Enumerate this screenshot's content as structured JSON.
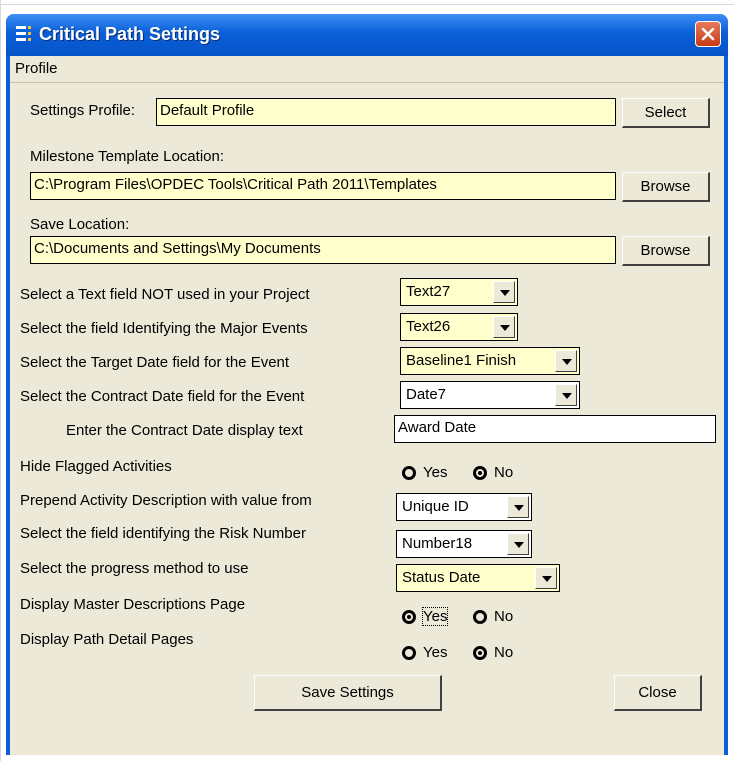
{
  "window": {
    "title": "Critical Path Settings",
    "close_symbol": "✕",
    "colors": {
      "titlebar": "#0a5fd8",
      "client": "#ece9d8",
      "field_yellow": "#ffffcc"
    }
  },
  "menu": {
    "items": [
      {
        "label": "Profile"
      }
    ]
  },
  "settings_profile": {
    "label": "Settings Profile:",
    "value": "Default Profile",
    "button": "Select"
  },
  "milestone_template": {
    "label": "Milestone Template Location:",
    "value": "C:\\Program Files\\OPDEC Tools\\Critical Path 2011\\Templates",
    "button": "Browse"
  },
  "save_location": {
    "label": "Save Location:",
    "value": "C:\\Documents and Settings\\My Documents",
    "button": "Browse"
  },
  "rows": {
    "text_field": {
      "label": "Select a Text field NOT used in your Project",
      "value": "Text27"
    },
    "major_events": {
      "label": "Select the field Identifying the Major Events",
      "value": "Text26"
    },
    "target_date": {
      "label": "Select the Target Date field for the Event",
      "value": "Baseline1 Finish"
    },
    "contract_date": {
      "label": "Select the Contract Date field for the Event",
      "value": "Date7"
    },
    "contract_text": {
      "label": "Enter the Contract Date display text",
      "value": "Award Date"
    },
    "hide_flagged": {
      "label": "Hide Flagged Activities",
      "yes": "Yes",
      "no": "No",
      "selected": "No"
    },
    "prepend": {
      "label": "Prepend Activity Description with value from",
      "value": "Unique ID"
    },
    "risk_number": {
      "label": "Select the field identifying the Risk Number",
      "value": "Number18"
    },
    "progress": {
      "label": "Select the progress method to use",
      "value": "Status Date"
    },
    "master_desc": {
      "label": "Display Master Descriptions Page",
      "yes": "Yes",
      "no": "No",
      "selected": "Yes"
    },
    "path_detail": {
      "label": "Display Path Detail Pages",
      "yes": "Yes",
      "no": "No",
      "selected": "No"
    }
  },
  "footer": {
    "save": "Save Settings",
    "close": "Close"
  }
}
